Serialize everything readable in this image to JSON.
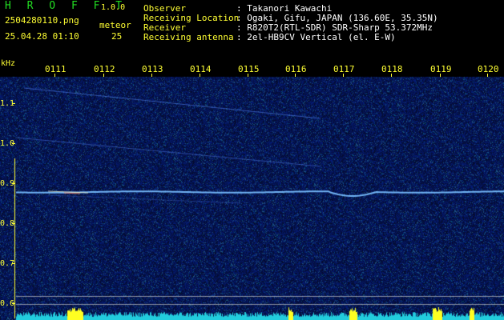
{
  "app": {
    "logo": "H R O F F T",
    "version": "1.0.0"
  },
  "file": {
    "name": "2504280110.png",
    "datetime": "25.04.28 01:10"
  },
  "meteor": {
    "label": "meteor",
    "count": "25"
  },
  "info": [
    {
      "label": "Observer",
      "value": ": Takanori Kawachi"
    },
    {
      "label": "Receiving Location",
      "value": ": Ogaki, Gifu, JAPAN (136.60E, 35.35N)"
    },
    {
      "label": "Receiver",
      "value": ": R820T2(RTL-SDR) SDR-Sharp 53.372MHz"
    },
    {
      "label": "Receiving antenna",
      "value": ": 2el-HB9CV Vertical (el. E-W)"
    }
  ],
  "axis": {
    "unit": "kHz",
    "y_labels": [
      "1.1",
      "1.0",
      "0.9",
      "0.8",
      "0.7",
      "0.6"
    ],
    "x_labels": [
      "0111",
      "0112",
      "0113",
      "0114",
      "0115",
      "0116",
      "0117",
      "0118",
      "0119",
      "0120"
    ]
  },
  "colors": {
    "background": "#000000",
    "text_yellow": "#ffff33",
    "logo_green": "#22dd22",
    "noise_blue": "#0a1f6a",
    "signal": "#66aaff",
    "meter": "#22ccdd"
  }
}
